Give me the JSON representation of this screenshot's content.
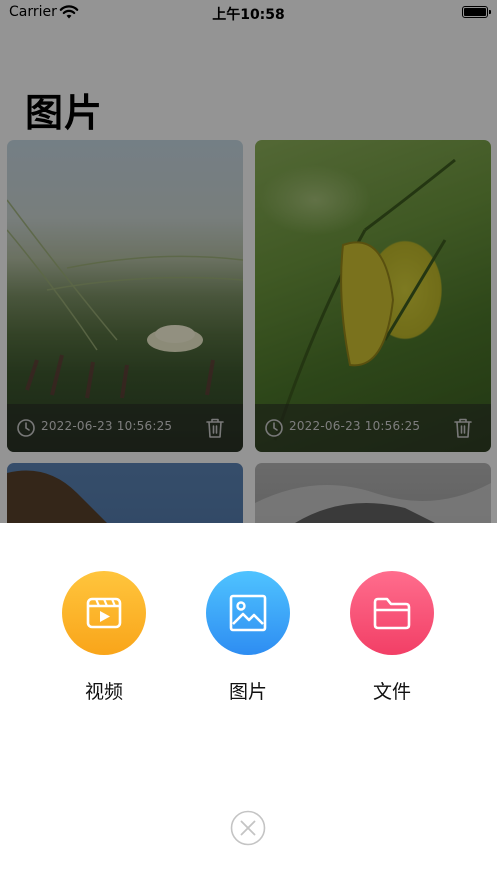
{
  "status_bar": {
    "carrier": "Carrier",
    "time": "上午10:58"
  },
  "page": {
    "title": "图片"
  },
  "grid": {
    "items": [
      {
        "date": "2022-06-23 10:56:25"
      },
      {
        "date": "2022-06-23 10:56:25"
      },
      {
        "date": ""
      },
      {
        "date": ""
      }
    ]
  },
  "sheet": {
    "actions": [
      {
        "label": "视频",
        "icon": "video-icon",
        "color": "#f9a51a"
      },
      {
        "label": "图片",
        "icon": "image-icon",
        "color": "#2e8df2"
      },
      {
        "label": "文件",
        "icon": "folder-icon",
        "color": "#f23f66"
      }
    ],
    "close_icon": "close-circle-icon"
  }
}
